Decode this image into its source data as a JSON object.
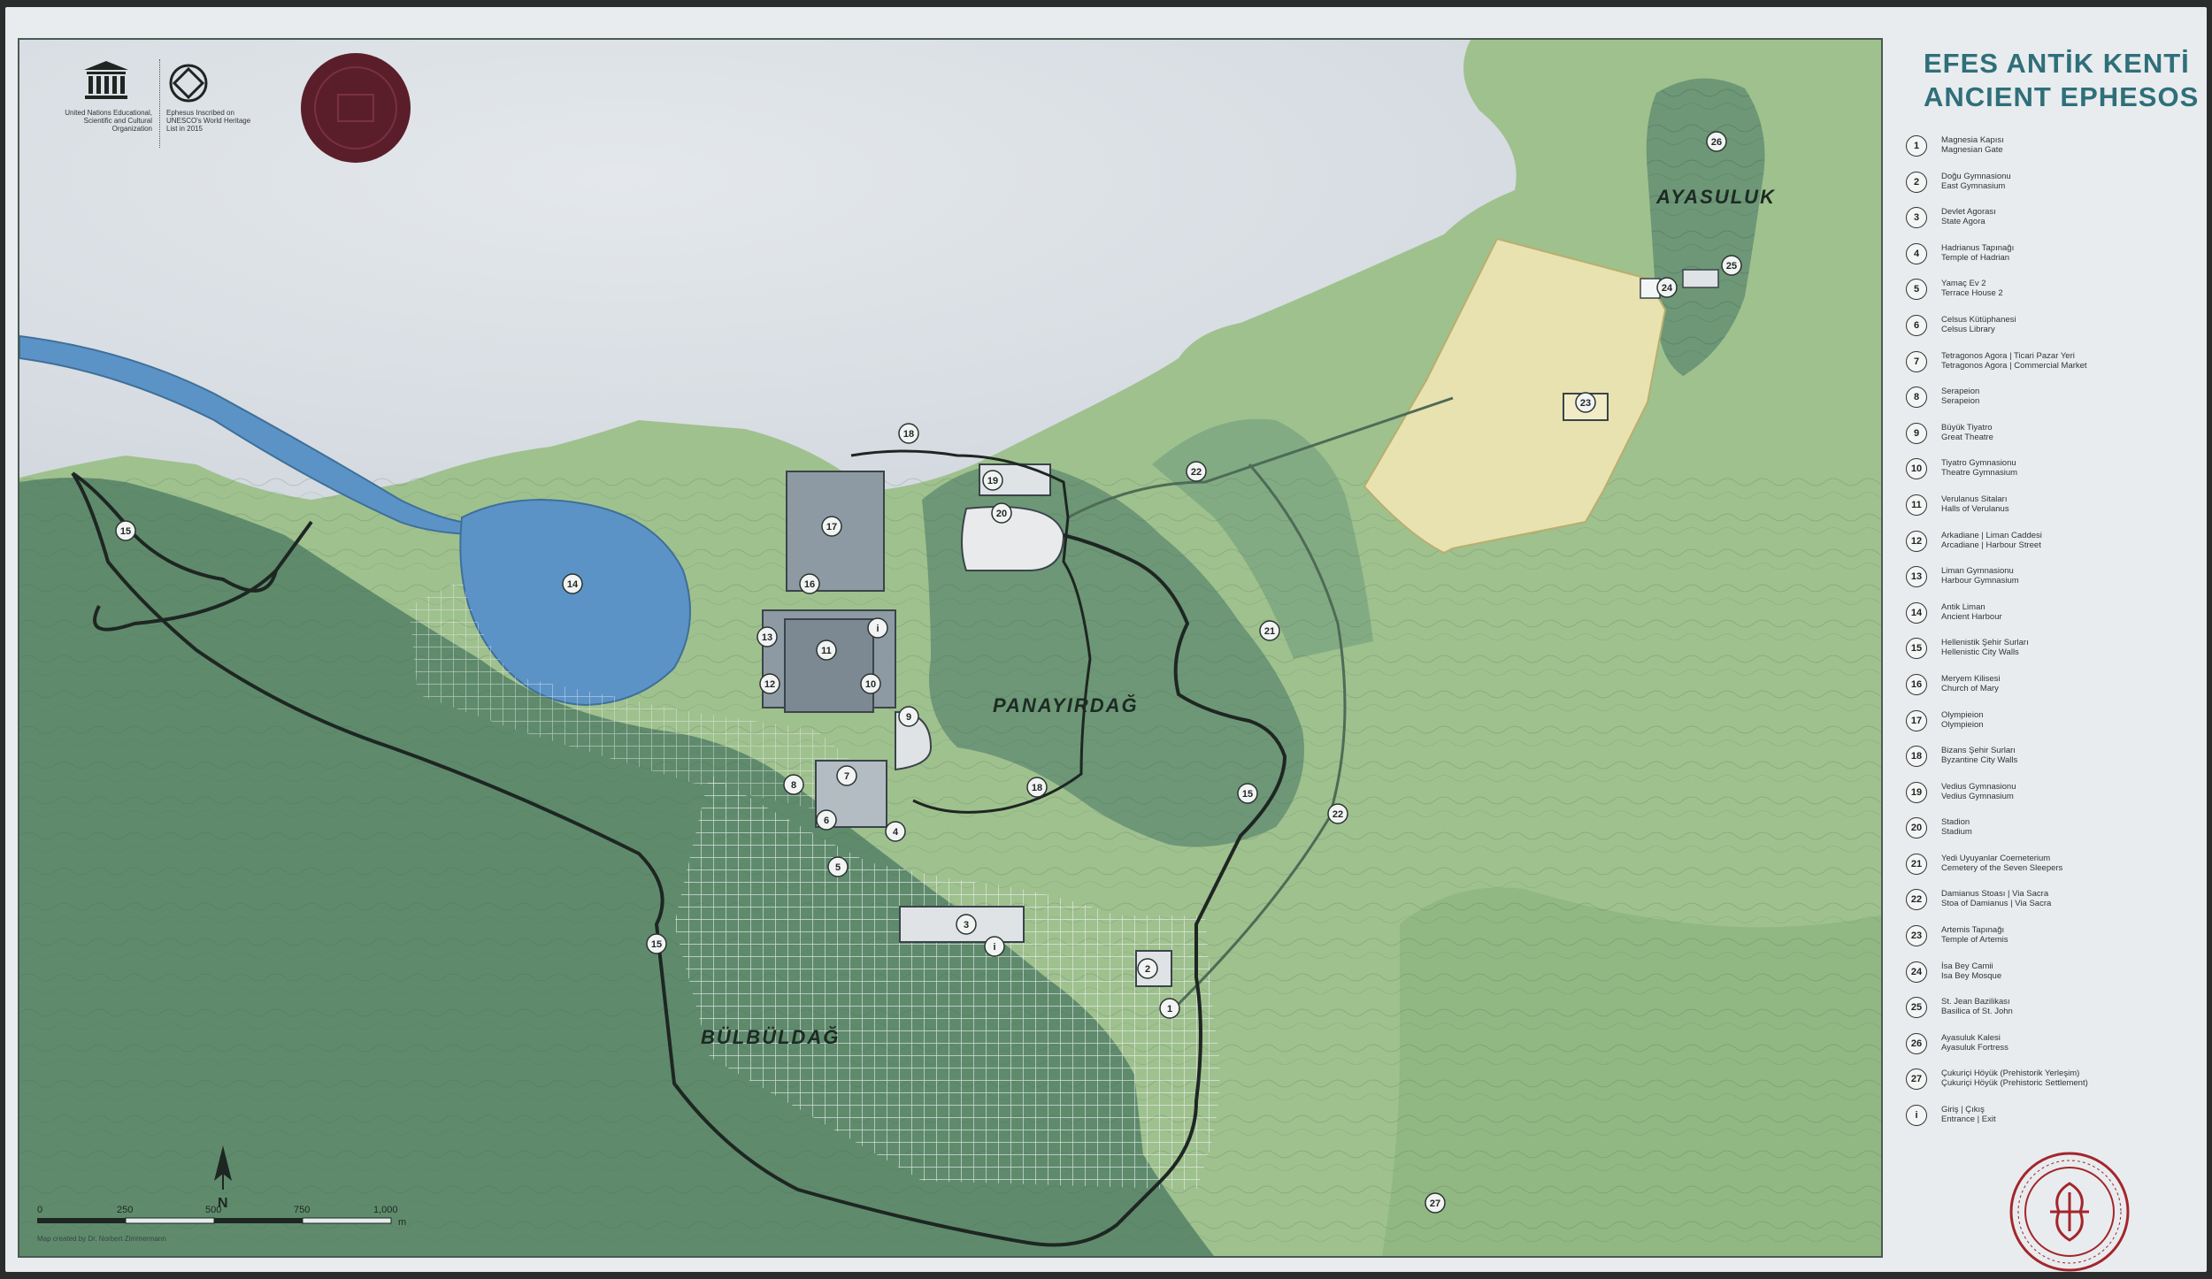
{
  "title": {
    "tr": "EFES ANTİK KENTİ",
    "en": "ANCIENT EPHESOS"
  },
  "logos": {
    "unesco_caption": "United Nations Educational, Scientific and Cultural Organization",
    "whc_caption": "Ephesus Inscribed on UNESCO's World Heritage List in 2015"
  },
  "map": {
    "region_labels": {
      "ayasuluk": "AYASULUK",
      "panayirdag": "PANAYIRDAĞ",
      "bulbuldag": "BÜLBÜLDAĞ"
    },
    "north_label": "N",
    "scale": {
      "ticks": [
        "0",
        "250",
        "500",
        "750",
        "1,000"
      ],
      "unit": "m"
    },
    "credit": "Map created by Dr. Norbert Zimmermann"
  },
  "legend": [
    {
      "num": "1",
      "tr": "Magnesia Kapısı",
      "en": "Magnesian Gate"
    },
    {
      "num": "2",
      "tr": "Doğu Gymnasionu",
      "en": "East Gymnasium"
    },
    {
      "num": "3",
      "tr": "Devlet Agorası",
      "en": "State Agora"
    },
    {
      "num": "4",
      "tr": "Hadrianus Tapınağı",
      "en": "Temple of Hadrian"
    },
    {
      "num": "5",
      "tr": "Yamaç Ev 2",
      "en": "Terrace House 2"
    },
    {
      "num": "6",
      "tr": "Celsus Kütüphanesi",
      "en": "Celsus Library"
    },
    {
      "num": "7",
      "tr": "Tetragonos Agora | Ticari Pazar Yeri",
      "en": "Tetragonos Agora | Commercial Market"
    },
    {
      "num": "8",
      "tr": "Serapeion",
      "en": "Serapeion"
    },
    {
      "num": "9",
      "tr": "Büyük Tiyatro",
      "en": "Great Theatre"
    },
    {
      "num": "10",
      "tr": "Tiyatro Gymnasionu",
      "en": "Theatre Gymnasium"
    },
    {
      "num": "11",
      "tr": "Verulanus Sitaları",
      "en": "Halls of Verulanus"
    },
    {
      "num": "12",
      "tr": "Arkadiane | Liman Caddesi",
      "en": "Arcadiane | Harbour Street"
    },
    {
      "num": "13",
      "tr": "Liman Gymnasionu",
      "en": "Harbour Gymnasium"
    },
    {
      "num": "14",
      "tr": "Antik Liman",
      "en": "Ancient Harbour"
    },
    {
      "num": "15",
      "tr": "Hellenistik Şehir Surları",
      "en": "Hellenistic City Walls"
    },
    {
      "num": "16",
      "tr": "Meryem Kilisesi",
      "en": "Church of Mary"
    },
    {
      "num": "17",
      "tr": "Olympieion",
      "en": "Olympieion"
    },
    {
      "num": "18",
      "tr": "Bizans Şehir Surları",
      "en": "Byzantine City Walls"
    },
    {
      "num": "19",
      "tr": "Vedius Gymnasionu",
      "en": "Vedius Gymnasium"
    },
    {
      "num": "20",
      "tr": "Stadion",
      "en": "Stadium"
    },
    {
      "num": "21",
      "tr": "Yedi Uyuyanlar Coemeterium",
      "en": "Cemetery of the Seven Sleepers"
    },
    {
      "num": "22",
      "tr": "Damianus Stoası | Via Sacra",
      "en": "Stoa of Damianus | Via Sacra"
    },
    {
      "num": "23",
      "tr": "Artemis Tapınağı",
      "en": "Temple of Artemis"
    },
    {
      "num": "24",
      "tr": "İsa Bey Camii",
      "en": "Isa Bey Mosque"
    },
    {
      "num": "25",
      "tr": "St. Jean Bazilikası",
      "en": "Basilica of St. John"
    },
    {
      "num": "26",
      "tr": "Ayasuluk Kalesi",
      "en": "Ayasuluk Fortress"
    },
    {
      "num": "27",
      "tr": "Çukuriçi Höyük (Prehistorik Yerleşim)",
      "en": "Çukuriçi Höyük (Prehistoric Settlement)"
    },
    {
      "num": "i",
      "tr": "Giriş | Çıkış",
      "en": "Entrance | Exit"
    }
  ],
  "colors": {
    "sea": "#dfe4e8",
    "plain": "#9fc18e",
    "hills": "#5f8b6c",
    "harbour": "#5b93c7",
    "artemis_zone": "#e8e2b0",
    "wall": "#1e2622",
    "title": "#2f6f7a",
    "seal": "#a3262c",
    "unesco_badge": "#5a1e2a"
  },
  "icons": [
    "unesco-logo-icon",
    "world-heritage-icon",
    "unesco-badge-icon",
    "north-arrow-icon",
    "ministry-seal-icon"
  ]
}
